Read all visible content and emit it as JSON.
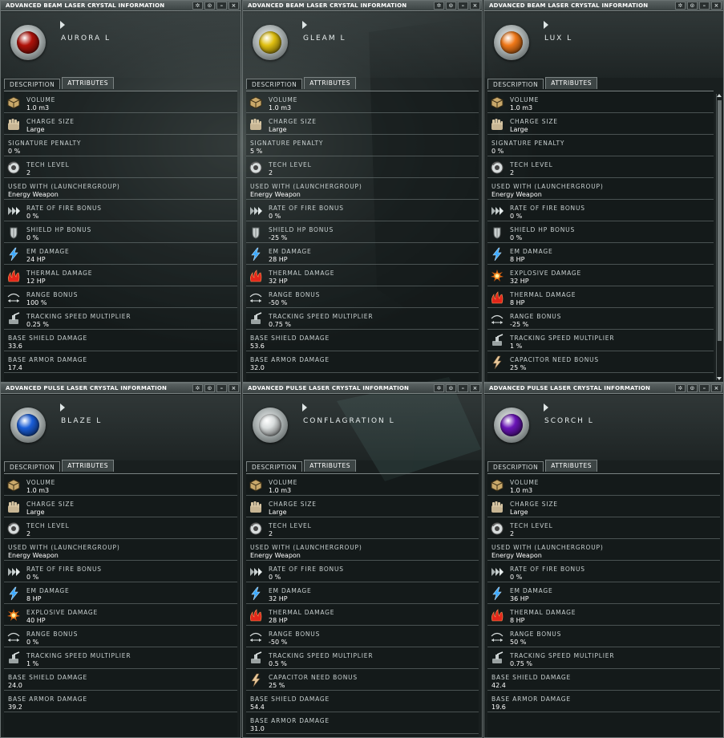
{
  "windows": [
    {
      "title": "ADVANCED BEAM LASER CRYSTAL INFORMATION",
      "name": "AURORA L",
      "gem_color": "#b0120a",
      "tabs": [
        "DESCRIPTION",
        "ATTRIBUTES"
      ],
      "scrollbar": false,
      "attributes": [
        {
          "label": "VOLUME",
          "value": "1.0 m3",
          "icon": "box-icon"
        },
        {
          "label": "CHARGE SIZE",
          "value": "Large",
          "icon": "hand-icon"
        },
        {
          "label": "SIGNATURE PENALTY",
          "value": "0 %",
          "icon": ""
        },
        {
          "label": "TECH LEVEL",
          "value": "2",
          "icon": "tech-icon"
        },
        {
          "label": "USED WITH (LAUNCHERGROUP)",
          "value": "Energy Weapon",
          "icon": ""
        },
        {
          "label": "RATE OF FIRE BONUS",
          "value": "0 %",
          "icon": "chevrons-icon"
        },
        {
          "label": "SHIELD HP BONUS",
          "value": "0 %",
          "icon": "shield-icon"
        },
        {
          "label": "EM DAMAGE",
          "value": "24 HP",
          "icon": "em-icon"
        },
        {
          "label": "THERMAL DAMAGE",
          "value": "12 HP",
          "icon": "thermal-icon"
        },
        {
          "label": "RANGE BONUS",
          "value": "100 %",
          "icon": "range-icon"
        },
        {
          "label": "TRACKING SPEED MULTIPLIER",
          "value": "0.25 %",
          "icon": "tracking-icon"
        },
        {
          "label": "BASE SHIELD DAMAGE",
          "value": "33.6",
          "icon": ""
        },
        {
          "label": "BASE ARMOR DAMAGE",
          "value": "17.4",
          "icon": ""
        }
      ]
    },
    {
      "title": "ADVANCED BEAM LASER CRYSTAL INFORMATION",
      "name": "GLEAM L",
      "gem_color": "#e0c010",
      "tabs": [
        "DESCRIPTION",
        "ATTRIBUTES"
      ],
      "scrollbar": false,
      "attributes": [
        {
          "label": "VOLUME",
          "value": "1.0 m3",
          "icon": "box-icon"
        },
        {
          "label": "CHARGE SIZE",
          "value": "Large",
          "icon": "hand-icon"
        },
        {
          "label": "SIGNATURE PENALTY",
          "value": "5 %",
          "icon": ""
        },
        {
          "label": "TECH LEVEL",
          "value": "2",
          "icon": "tech-icon"
        },
        {
          "label": "USED WITH (LAUNCHERGROUP)",
          "value": "Energy Weapon",
          "icon": ""
        },
        {
          "label": "RATE OF FIRE BONUS",
          "value": "0 %",
          "icon": "chevrons-icon"
        },
        {
          "label": "SHIELD HP BONUS",
          "value": "-25 %",
          "icon": "shield-icon"
        },
        {
          "label": "EM DAMAGE",
          "value": "28 HP",
          "icon": "em-icon"
        },
        {
          "label": "THERMAL DAMAGE",
          "value": "32 HP",
          "icon": "thermal-icon"
        },
        {
          "label": "RANGE BONUS",
          "value": "-50 %",
          "icon": "range-icon"
        },
        {
          "label": "TRACKING SPEED MULTIPLIER",
          "value": "0.75 %",
          "icon": "tracking-icon"
        },
        {
          "label": "BASE SHIELD DAMAGE",
          "value": "53.6",
          "icon": ""
        },
        {
          "label": "BASE ARMOR DAMAGE",
          "value": "32.0",
          "icon": ""
        }
      ]
    },
    {
      "title": "ADVANCED BEAM LASER CRYSTAL INFORMATION",
      "name": "LUX L",
      "gem_color": "#f07818",
      "tabs": [
        "DESCRIPTION",
        "ATTRIBUTES"
      ],
      "scrollbar": true,
      "attributes": [
        {
          "label": "VOLUME",
          "value": "1.0 m3",
          "icon": "box-icon"
        },
        {
          "label": "CHARGE SIZE",
          "value": "Large",
          "icon": "hand-icon"
        },
        {
          "label": "SIGNATURE PENALTY",
          "value": "0 %",
          "icon": ""
        },
        {
          "label": "TECH LEVEL",
          "value": "2",
          "icon": "tech-icon"
        },
        {
          "label": "USED WITH (LAUNCHERGROUP)",
          "value": "Energy Weapon",
          "icon": ""
        },
        {
          "label": "RATE OF FIRE BONUS",
          "value": "0 %",
          "icon": "chevrons-icon"
        },
        {
          "label": "SHIELD HP BONUS",
          "value": "0 %",
          "icon": "shield-icon"
        },
        {
          "label": "EM DAMAGE",
          "value": "8 HP",
          "icon": "em-icon"
        },
        {
          "label": "EXPLOSIVE DAMAGE",
          "value": "32 HP",
          "icon": "explosive-icon"
        },
        {
          "label": "THERMAL DAMAGE",
          "value": "8 HP",
          "icon": "thermal-icon"
        },
        {
          "label": "RANGE BONUS",
          "value": "-25 %",
          "icon": "range-icon"
        },
        {
          "label": "TRACKING SPEED MULTIPLIER",
          "value": "1 %",
          "icon": "tracking-icon"
        },
        {
          "label": "CAPACITOR NEED BONUS",
          "value": "25 %",
          "icon": "capacitor-icon"
        }
      ]
    },
    {
      "title": "ADVANCED PULSE LASER CRYSTAL INFORMATION",
      "name": "BLAZE L",
      "gem_color": "#1a5ed8",
      "tabs": [
        "DESCRIPTION",
        "ATTRIBUTES"
      ],
      "scrollbar": false,
      "attributes": [
        {
          "label": "VOLUME",
          "value": "1.0 m3",
          "icon": "box-icon"
        },
        {
          "label": "CHARGE SIZE",
          "value": "Large",
          "icon": "hand-icon"
        },
        {
          "label": "TECH LEVEL",
          "value": "2",
          "icon": "tech-icon"
        },
        {
          "label": "USED WITH (LAUNCHERGROUP)",
          "value": "Energy Weapon",
          "icon": ""
        },
        {
          "label": "RATE OF FIRE BONUS",
          "value": "0 %",
          "icon": "chevrons-icon"
        },
        {
          "label": "EM DAMAGE",
          "value": "8 HP",
          "icon": "em-icon"
        },
        {
          "label": "EXPLOSIVE DAMAGE",
          "value": "40 HP",
          "icon": "explosive-icon"
        },
        {
          "label": "RANGE BONUS",
          "value": "0 %",
          "icon": "range-icon"
        },
        {
          "label": "TRACKING SPEED MULTIPLIER",
          "value": "1 %",
          "icon": "tracking-icon"
        },
        {
          "label": "BASE SHIELD DAMAGE",
          "value": "24.0",
          "icon": ""
        },
        {
          "label": "BASE ARMOR DAMAGE",
          "value": "39.2",
          "icon": ""
        }
      ]
    },
    {
      "title": "ADVANCED PULSE LASER CRYSTAL INFORMATION",
      "name": "CONFLAGRATION L",
      "gem_color": "#d8dcdc",
      "tabs": [
        "DESCRIPTION",
        "ATTRIBUTES"
      ],
      "scrollbar": false,
      "attributes": [
        {
          "label": "VOLUME",
          "value": "1.0 m3",
          "icon": "box-icon"
        },
        {
          "label": "CHARGE SIZE",
          "value": "Large",
          "icon": "hand-icon"
        },
        {
          "label": "TECH LEVEL",
          "value": "2",
          "icon": "tech-icon"
        },
        {
          "label": "USED WITH (LAUNCHERGROUP)",
          "value": "Energy Weapon",
          "icon": ""
        },
        {
          "label": "RATE OF FIRE BONUS",
          "value": "0 %",
          "icon": "chevrons-icon"
        },
        {
          "label": "EM DAMAGE",
          "value": "32 HP",
          "icon": "em-icon"
        },
        {
          "label": "THERMAL DAMAGE",
          "value": "28 HP",
          "icon": "thermal-icon"
        },
        {
          "label": "RANGE BONUS",
          "value": "-50 %",
          "icon": "range-icon"
        },
        {
          "label": "TRACKING SPEED MULTIPLIER",
          "value": "0.5 %",
          "icon": "tracking-icon"
        },
        {
          "label": "CAPACITOR NEED BONUS",
          "value": "25 %",
          "icon": "capacitor-icon"
        },
        {
          "label": "BASE SHIELD DAMAGE",
          "value": "54.4",
          "icon": ""
        },
        {
          "label": "BASE ARMOR DAMAGE",
          "value": "31.0",
          "icon": ""
        }
      ]
    },
    {
      "title": "ADVANCED PULSE LASER CRYSTAL INFORMATION",
      "name": "SCORCH L",
      "gem_color": "#6a14b8",
      "tabs": [
        "DESCRIPTION",
        "ATTRIBUTES"
      ],
      "scrollbar": false,
      "attributes": [
        {
          "label": "VOLUME",
          "value": "1.0 m3",
          "icon": "box-icon"
        },
        {
          "label": "CHARGE SIZE",
          "value": "Large",
          "icon": "hand-icon"
        },
        {
          "label": "TECH LEVEL",
          "value": "2",
          "icon": "tech-icon"
        },
        {
          "label": "USED WITH (LAUNCHERGROUP)",
          "value": "Energy Weapon",
          "icon": ""
        },
        {
          "label": "RATE OF FIRE BONUS",
          "value": "0 %",
          "icon": "chevrons-icon"
        },
        {
          "label": "EM DAMAGE",
          "value": "36 HP",
          "icon": "em-icon"
        },
        {
          "label": "THERMAL DAMAGE",
          "value": "8 HP",
          "icon": "thermal-icon"
        },
        {
          "label": "RANGE BONUS",
          "value": "50 %",
          "icon": "range-icon"
        },
        {
          "label": "TRACKING SPEED MULTIPLIER",
          "value": "0.75 %",
          "icon": "tracking-icon"
        },
        {
          "label": "BASE SHIELD DAMAGE",
          "value": "42.4",
          "icon": ""
        },
        {
          "label": "BASE ARMOR DAMAGE",
          "value": "19.6",
          "icon": ""
        }
      ]
    }
  ],
  "title_buttons": [
    "✲",
    "⊙",
    "–",
    "×"
  ]
}
